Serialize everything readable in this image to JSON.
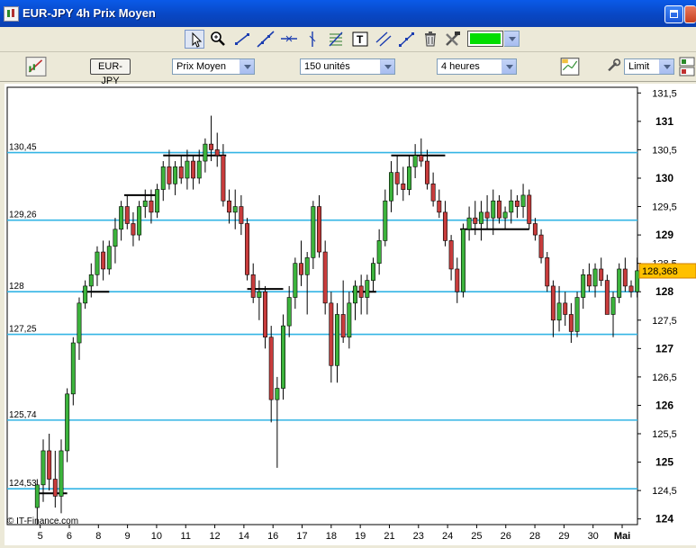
{
  "window": {
    "title": "EUR-JPY 4h Prix Moyen"
  },
  "toolbar2": {
    "symbol": "EUR-JPY",
    "price_type": "Prix Moyen",
    "units": "150 unités",
    "period": "4 heures",
    "order_type": "Limit"
  },
  "colors": {
    "draw_color": "#00dd00",
    "up": "#3cb43c",
    "down": "#c83c3c",
    "hline": "#33b5e5"
  },
  "footer": {
    "copyright": "© IT-Finance.com"
  },
  "chart_data": {
    "type": "candlestick",
    "ylim": [
      123.9,
      131.6
    ],
    "y_ticks": [
      "131,5",
      "131",
      "130,5",
      "130",
      "129,5",
      "129",
      "128,5",
      "128",
      "127,5",
      "127",
      "126,5",
      "126",
      "125,5",
      "125",
      "124,5",
      "124"
    ],
    "x_ticks": [
      "5",
      "6",
      "8",
      "9",
      "10",
      "11",
      "12",
      "14",
      "16",
      "17",
      "18",
      "19",
      "21",
      "23",
      "24",
      "25",
      "26",
      "28",
      "29",
      "30",
      "Mai"
    ],
    "current_price": "128,368",
    "horizontal_lines": [
      {
        "value": 130.45,
        "label": "130,45"
      },
      {
        "value": 129.26,
        "label": "129,26"
      },
      {
        "value": 128.0,
        "label": "128"
      },
      {
        "value": 127.25,
        "label": "127,25"
      },
      {
        "value": 125.74,
        "label": "125,74"
      },
      {
        "value": 124.53,
        "label": "124,53"
      }
    ],
    "candles": [
      [
        124.2,
        124.7,
        123.9,
        124.6
      ],
      [
        124.6,
        125.4,
        124.3,
        125.2
      ],
      [
        125.2,
        125.5,
        124.5,
        124.7
      ],
      [
        124.7,
        125.2,
        124.2,
        124.4
      ],
      [
        124.4,
        125.4,
        124.1,
        125.2
      ],
      [
        125.2,
        126.3,
        125.0,
        126.2
      ],
      [
        126.2,
        127.2,
        126.0,
        127.1
      ],
      [
        127.1,
        127.9,
        126.8,
        127.8
      ],
      [
        127.8,
        128.2,
        127.7,
        128.1
      ],
      [
        128.1,
        128.5,
        127.9,
        128.3
      ],
      [
        128.3,
        128.8,
        128.1,
        128.7
      ],
      [
        128.7,
        128.9,
        128.2,
        128.4
      ],
      [
        128.4,
        128.9,
        128.3,
        128.8
      ],
      [
        128.8,
        129.3,
        128.5,
        129.1
      ],
      [
        129.1,
        129.6,
        128.9,
        129.5
      ],
      [
        129.5,
        129.7,
        129.1,
        129.2
      ],
      [
        129.2,
        129.4,
        128.8,
        129.0
      ],
      [
        129.0,
        129.6,
        128.9,
        129.5
      ],
      [
        129.5,
        129.8,
        129.3,
        129.6
      ],
      [
        129.6,
        129.8,
        129.2,
        129.4
      ],
      [
        129.4,
        129.9,
        129.3,
        129.8
      ],
      [
        129.8,
        130.3,
        129.6,
        130.2
      ],
      [
        130.2,
        130.5,
        129.8,
        129.9
      ],
      [
        129.9,
        130.3,
        129.7,
        130.2
      ],
      [
        130.2,
        130.4,
        129.9,
        130.0
      ],
      [
        130.0,
        130.5,
        129.8,
        130.3
      ],
      [
        130.3,
        130.4,
        129.8,
        130.0
      ],
      [
        130.0,
        130.5,
        129.9,
        130.3
      ],
      [
        130.3,
        130.7,
        130.1,
        130.6
      ],
      [
        130.6,
        131.1,
        130.3,
        130.5
      ],
      [
        130.5,
        130.8,
        130.2,
        130.4
      ],
      [
        130.4,
        130.6,
        129.5,
        129.6
      ],
      [
        129.6,
        129.8,
        129.2,
        129.4
      ],
      [
        129.4,
        129.8,
        129.1,
        129.5
      ],
      [
        129.5,
        129.7,
        129.0,
        129.2
      ],
      [
        129.2,
        129.3,
        128.2,
        128.3
      ],
      [
        128.3,
        128.5,
        127.8,
        127.9
      ],
      [
        127.9,
        128.2,
        127.5,
        128.0
      ],
      [
        128.0,
        128.1,
        127.0,
        127.2
      ],
      [
        127.2,
        127.4,
        125.7,
        126.1
      ],
      [
        126.1,
        126.5,
        124.9,
        126.3
      ],
      [
        126.3,
        127.6,
        126.1,
        127.4
      ],
      [
        127.4,
        128.1,
        127.2,
        127.9
      ],
      [
        127.9,
        128.6,
        127.7,
        128.5
      ],
      [
        128.5,
        128.9,
        128.1,
        128.3
      ],
      [
        128.3,
        128.7,
        127.6,
        128.6
      ],
      [
        128.6,
        129.6,
        128.4,
        129.5
      ],
      [
        129.5,
        129.7,
        128.6,
        128.7
      ],
      [
        128.7,
        128.9,
        127.6,
        127.8
      ],
      [
        127.8,
        128.0,
        126.4,
        126.7
      ],
      [
        126.7,
        127.8,
        126.4,
        127.6
      ],
      [
        127.6,
        128.2,
        127.1,
        127.2
      ],
      [
        127.2,
        128.0,
        127.0,
        127.8
      ],
      [
        127.8,
        128.2,
        127.5,
        128.1
      ],
      [
        128.1,
        128.3,
        127.6,
        127.9
      ],
      [
        127.9,
        128.3,
        127.6,
        128.2
      ],
      [
        128.2,
        128.6,
        128.0,
        128.5
      ],
      [
        128.5,
        129.1,
        128.3,
        128.9
      ],
      [
        128.9,
        129.8,
        128.8,
        129.6
      ],
      [
        129.6,
        130.3,
        129.4,
        130.1
      ],
      [
        130.1,
        130.4,
        129.7,
        129.9
      ],
      [
        129.9,
        130.2,
        129.6,
        129.8
      ],
      [
        129.8,
        130.4,
        129.7,
        130.2
      ],
      [
        130.2,
        130.6,
        130.0,
        130.4
      ],
      [
        130.4,
        130.7,
        130.2,
        130.3
      ],
      [
        130.3,
        130.5,
        129.8,
        129.9
      ],
      [
        129.9,
        130.1,
        129.5,
        129.6
      ],
      [
        129.6,
        129.8,
        129.3,
        129.4
      ],
      [
        129.4,
        129.6,
        128.8,
        128.9
      ],
      [
        128.9,
        129.0,
        128.2,
        128.4
      ],
      [
        128.4,
        128.6,
        127.8,
        128.0
      ],
      [
        128.0,
        129.2,
        127.9,
        129.1
      ],
      [
        129.1,
        129.5,
        128.9,
        129.3
      ],
      [
        129.3,
        129.6,
        129.0,
        129.2
      ],
      [
        129.2,
        129.6,
        128.9,
        129.4
      ],
      [
        129.4,
        129.7,
        129.1,
        129.3
      ],
      [
        129.3,
        129.8,
        129.0,
        129.6
      ],
      [
        129.6,
        129.7,
        129.2,
        129.3
      ],
      [
        129.3,
        129.5,
        129.1,
        129.4
      ],
      [
        129.4,
        129.8,
        129.2,
        129.6
      ],
      [
        129.6,
        129.7,
        129.3,
        129.5
      ],
      [
        129.5,
        129.9,
        129.3,
        129.7
      ],
      [
        129.7,
        129.8,
        129.1,
        129.2
      ],
      [
        129.2,
        129.3,
        128.9,
        129.0
      ],
      [
        129.0,
        129.1,
        128.5,
        128.6
      ],
      [
        128.6,
        128.7,
        128.0,
        128.1
      ],
      [
        128.1,
        128.2,
        127.2,
        127.5
      ],
      [
        127.5,
        128.1,
        127.3,
        127.8
      ],
      [
        127.8,
        128.0,
        127.4,
        127.6
      ],
      [
        127.6,
        127.8,
        127.1,
        127.3
      ],
      [
        127.3,
        128.0,
        127.2,
        127.9
      ],
      [
        127.9,
        128.4,
        127.7,
        128.3
      ],
      [
        128.3,
        128.5,
        128.0,
        128.1
      ],
      [
        128.1,
        128.5,
        127.9,
        128.4
      ],
      [
        128.4,
        128.6,
        128.1,
        128.2
      ],
      [
        128.2,
        128.3,
        127.6,
        127.6
      ],
      [
        127.6,
        128.0,
        127.2,
        127.9
      ],
      [
        127.9,
        128.5,
        127.8,
        128.4
      ],
      [
        128.4,
        128.6,
        128.0,
        128.1
      ],
      [
        128.1,
        128.2,
        127.9,
        128.0
      ],
      [
        128.0,
        128.6,
        127.9,
        128.37
      ]
    ],
    "support_segments": [
      {
        "x0": 0.5,
        "x1": 5.5,
        "y": 124.45
      },
      {
        "x0": 8.0,
        "x1": 12.5,
        "y": 128.0
      },
      {
        "x0": 15.0,
        "x1": 20.5,
        "y": 129.7
      },
      {
        "x0": 21.5,
        "x1": 32.0,
        "y": 130.4
      },
      {
        "x0": 35.5,
        "x1": 41.5,
        "y": 128.05
      },
      {
        "x0": 53.0,
        "x1": 57.0,
        "y": 128.0
      },
      {
        "x0": 59.5,
        "x1": 68.5,
        "y": 130.4
      },
      {
        "x0": 71.0,
        "x1": 82.5,
        "y": 129.1
      }
    ]
  }
}
